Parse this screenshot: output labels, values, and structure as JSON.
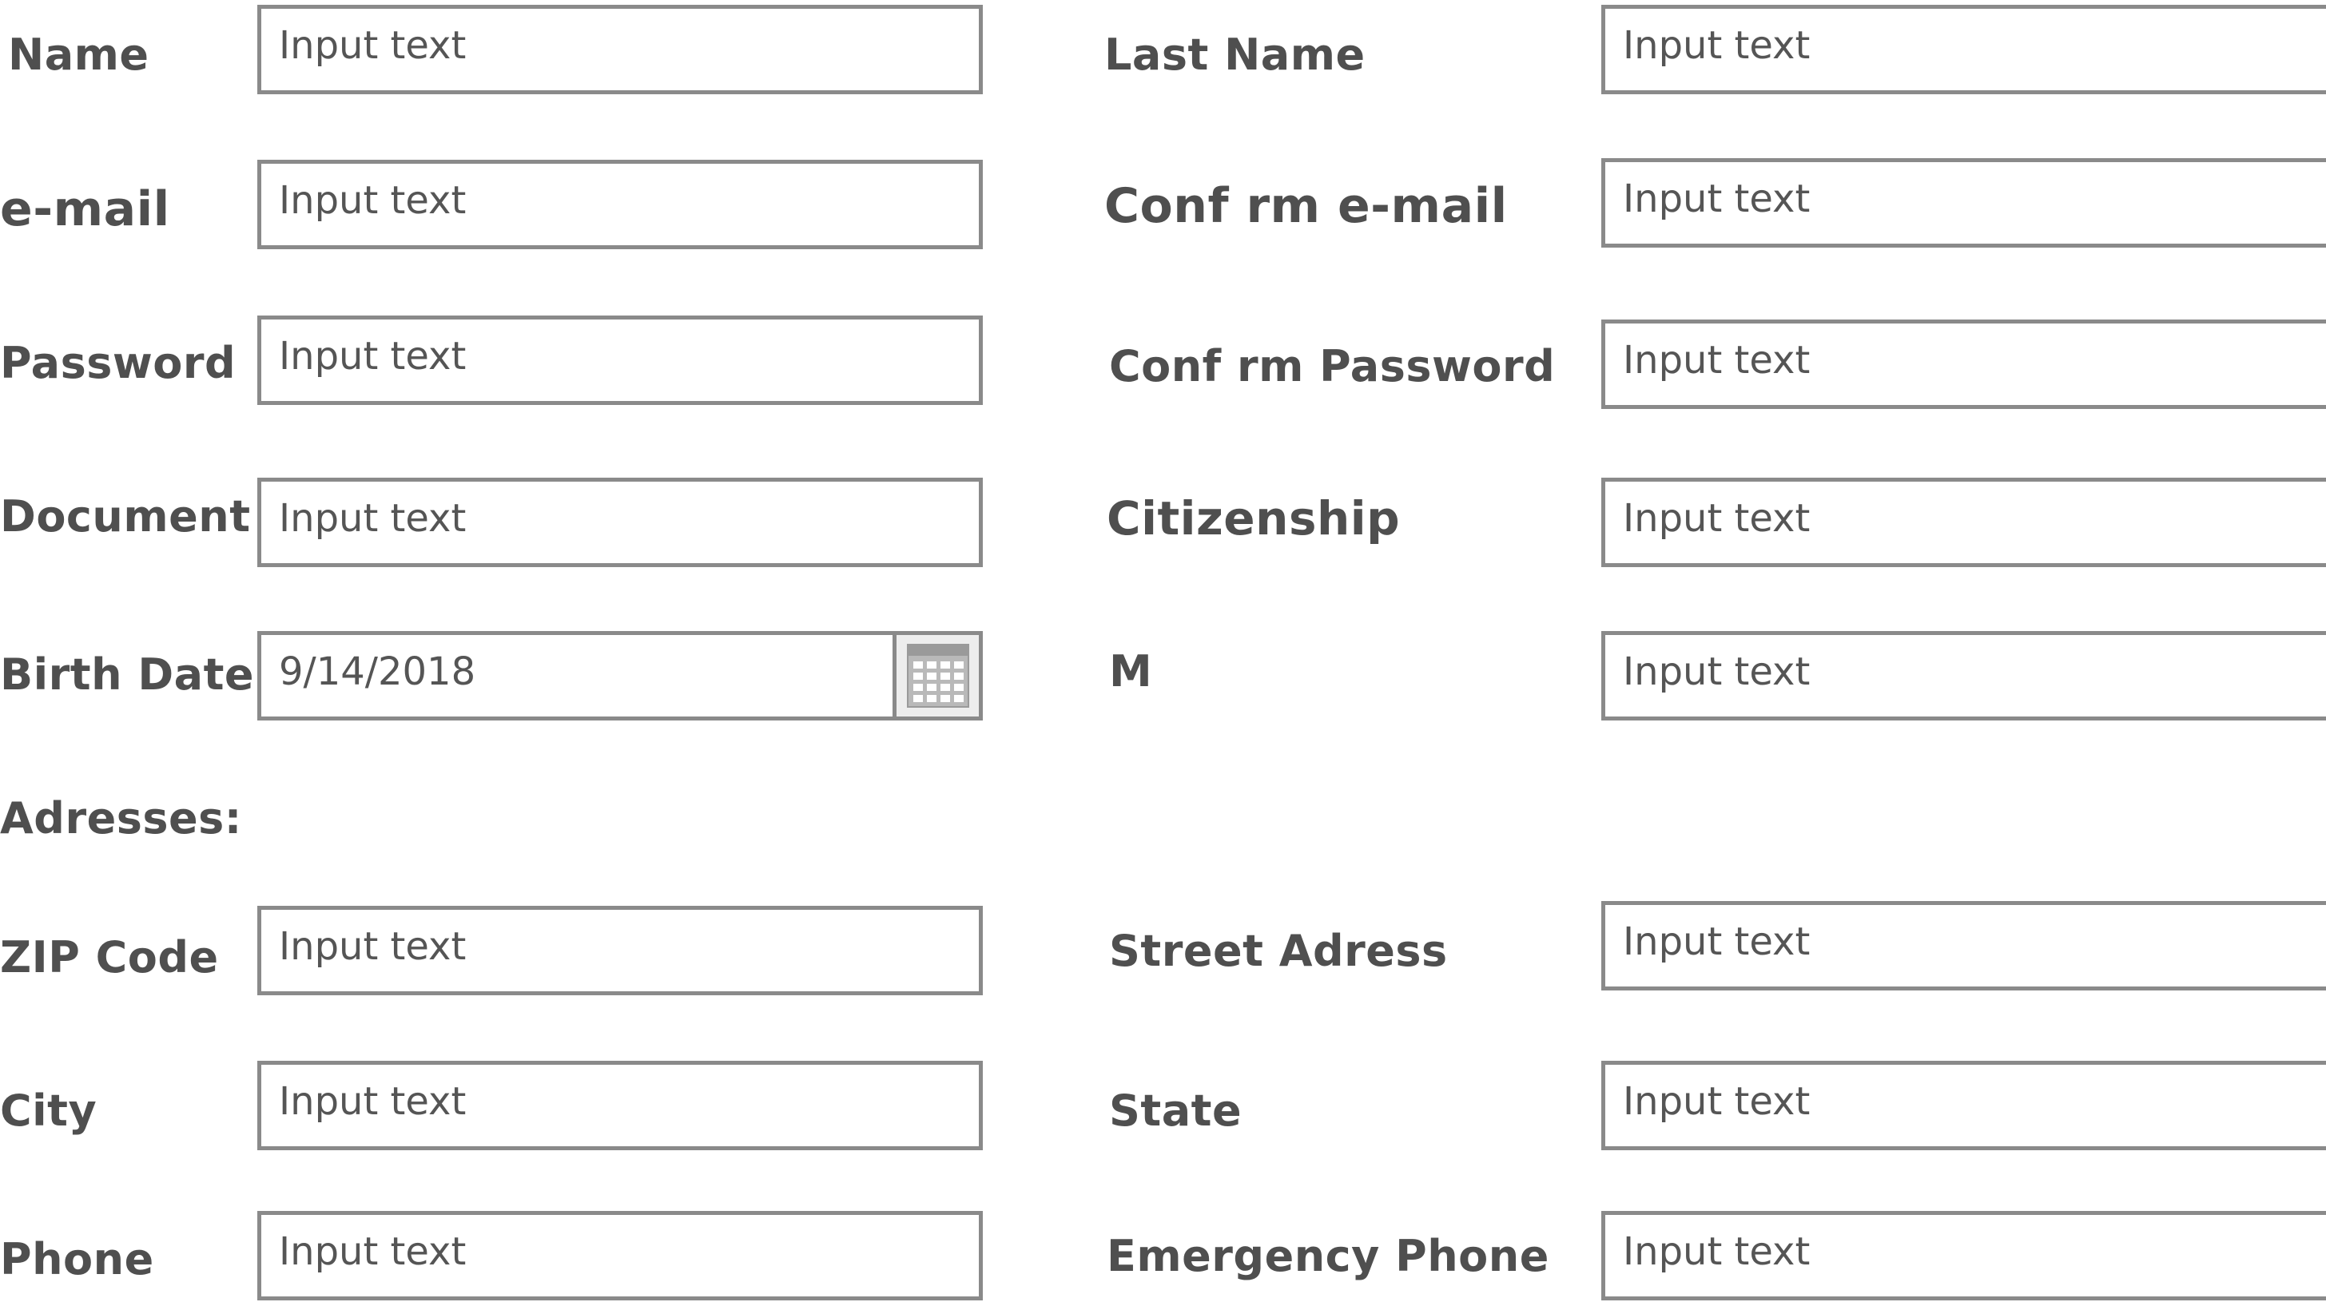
{
  "form": {
    "rows": [
      {
        "left": {
          "label": "Name",
          "value": "Input text"
        },
        "right": {
          "label": "Last Name",
          "value": "Input text"
        }
      },
      {
        "left": {
          "label": "e-mail",
          "value": "Input text"
        },
        "right": {
          "label": "Conf rm e-mail",
          "value": "Input text"
        }
      },
      {
        "left": {
          "label": "Password",
          "value": "Input text"
        },
        "right": {
          "label": "Conf rm Password",
          "value": "Input text"
        }
      },
      {
        "left": {
          "label": "Document",
          "value": "Input text"
        },
        "right": {
          "label": "Citizenship",
          "value": "Input text"
        }
      },
      {
        "left": {
          "label": "Birth Date",
          "value": "9/14/2018",
          "icon": "calendar-icon"
        },
        "right": {
          "label": "M",
          "value": "Input text"
        }
      }
    ],
    "section_heading": "Adresses:",
    "address_rows": [
      {
        "left": {
          "label": "ZIP Code",
          "value": "Input text"
        },
        "right": {
          "label": "Street Adress",
          "value": "Input text"
        }
      },
      {
        "left": {
          "label": "City",
          "value": "Input text"
        },
        "right": {
          "label": "State",
          "value": "Input text"
        }
      },
      {
        "left": {
          "label": "Phone",
          "value": "Input text"
        },
        "right": {
          "label": "Emergency Phone",
          "value": "Input text"
        }
      }
    ]
  },
  "colors": {
    "label_text": "#4f4f4f",
    "field_border": "#8a8a8a",
    "field_text": "#555555",
    "background": "#ffffff"
  }
}
